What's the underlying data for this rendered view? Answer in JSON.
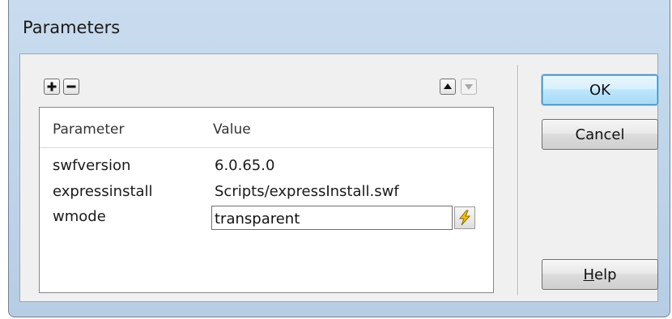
{
  "dialog": {
    "title": "Parameters"
  },
  "toolbar": {
    "add_icon": "plus-icon",
    "remove_icon": "minus-icon",
    "move_up_icon": "arrow-up-icon",
    "move_down_icon": "arrow-down-icon",
    "move_down_enabled": false
  },
  "table": {
    "headers": {
      "parameter": "Parameter",
      "value": "Value"
    },
    "rows": [
      {
        "parameter": "swfversion",
        "value": "6.0.65.0"
      },
      {
        "parameter": "expressinstall",
        "value": "Scripts/expressInstall.swf"
      },
      {
        "parameter": "wmode",
        "value": "transparent"
      }
    ],
    "editing_row": 2,
    "dynamic_data_icon": "lightning-bolt-icon"
  },
  "buttons": {
    "ok": "OK",
    "cancel": "Cancel",
    "help_prefix": "",
    "help_hotkey": "H",
    "help_rest": "elp"
  },
  "colors": {
    "title_bar": "#c9dcef",
    "default_button_border": "#3c7fb1",
    "bolt_fill": "#f2c200"
  }
}
